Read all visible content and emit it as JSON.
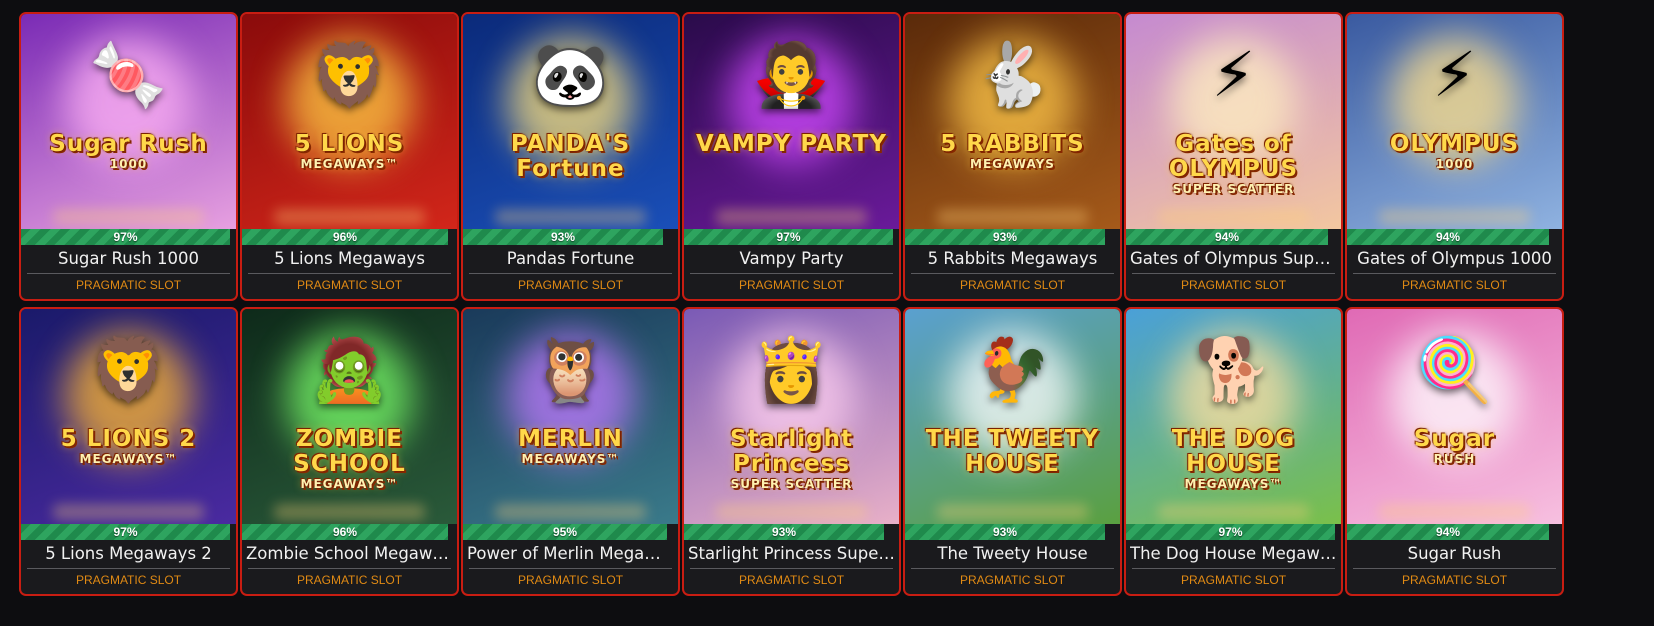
{
  "games": [
    {
      "title": "Sugar Rush 1000",
      "provider": "PRAGMATIC SLOT",
      "rtp": "97%",
      "rtp_value": 97,
      "logo_line1": "Sugar Rush",
      "logo_line2": "1000",
      "icon": "candy-egg-icon",
      "glyph": "🍬",
      "bg1": "#7a2bb5",
      "bg2": "#e7a0e0",
      "glow": "#ffb3f5"
    },
    {
      "title": "5 Lions Megaways",
      "provider": "PRAGMATIC SLOT",
      "rtp": "96%",
      "rtp_value": 96,
      "logo_line1": "5 LIONS",
      "logo_line2": "MEGAWAYS™",
      "icon": "golden-lion-icon",
      "glyph": "🦁",
      "bg1": "#8a0b0b",
      "bg2": "#d2261a",
      "glow": "#ffcc44"
    },
    {
      "title": "Pandas Fortune",
      "provider": "PRAGMATIC SLOT",
      "rtp": "93%",
      "rtp_value": 93,
      "logo_line1": "PANDA'S Fortune",
      "logo_line2": "",
      "icon": "panda-icon",
      "glyph": "🐼",
      "bg1": "#0b2a7a",
      "bg2": "#1a4fb8",
      "glow": "#ffe27a"
    },
    {
      "title": "Vampy Party",
      "provider": "PRAGMATIC SLOT",
      "rtp": "97%",
      "rtp_value": 97,
      "logo_line1": "VAMPY PARTY",
      "logo_line2": "",
      "icon": "vampire-icon",
      "glyph": "🧛",
      "bg1": "#2a0b4a",
      "bg2": "#6a1a9a",
      "glow": "#d24bff"
    },
    {
      "title": "5 Rabbits Megaways",
      "provider": "PRAGMATIC SLOT",
      "rtp": "93%",
      "rtp_value": 93,
      "logo_line1": "5 RABBITS",
      "logo_line2": "MEGAWAYS",
      "icon": "golden-rabbit-icon",
      "glyph": "🐇",
      "bg1": "#5a2a0a",
      "bg2": "#a55a1a",
      "glow": "#ffc84a"
    },
    {
      "title": "Gates of Olympus Super Scatter",
      "provider": "PRAGMATIC SLOT",
      "rtp": "94%",
      "rtp_value": 94,
      "logo_line1": "Gates of OLYMPUS",
      "logo_line2": "SUPER SCATTER",
      "icon": "zeus-icon",
      "glyph": "⚡",
      "bg1": "#c58ad0",
      "bg2": "#f3c7a0",
      "glow": "#fff0c0"
    },
    {
      "title": "Gates of Olympus 1000",
      "provider": "PRAGMATIC SLOT",
      "rtp": "94%",
      "rtp_value": 94,
      "logo_line1": "OLYMPUS",
      "logo_line2": "1000",
      "icon": "zeus-icon",
      "glyph": "⚡",
      "bg1": "#3a5aa0",
      "bg2": "#8fb2e0",
      "glow": "#ffe08a"
    },
    {
      "title": "5 Lions Megaways 2",
      "provider": "PRAGMATIC SLOT",
      "rtp": "97%",
      "rtp_value": 97,
      "logo_line1": "5 LIONS 2",
      "logo_line2": "MEGAWAYS™",
      "icon": "golden-lion-icon",
      "glyph": "🦁",
      "bg1": "#1a1a6a",
      "bg2": "#4a2aa0",
      "glow": "#ffb830"
    },
    {
      "title": "Zombie School Megaways",
      "provider": "PRAGMATIC SLOT",
      "rtp": "96%",
      "rtp_value": 96,
      "logo_line1": "ZOMBIE SCHOOL",
      "logo_line2": "MEGAWAYS™",
      "icon": "zombie-icon",
      "glyph": "🧟",
      "bg1": "#0e2a1a",
      "bg2": "#2a5a3a",
      "glow": "#7aff6a"
    },
    {
      "title": "Power of Merlin Megaways",
      "provider": "PRAGMATIC SLOT",
      "rtp": "95%",
      "rtp_value": 95,
      "logo_line1": "MERLIN",
      "logo_line2": "MEGAWAYS™",
      "icon": "owl-icon",
      "glyph": "🦉",
      "bg1": "#1a3a5a",
      "bg2": "#3a7a8a",
      "glow": "#c07aff"
    },
    {
      "title": "Starlight Princess Super Scatter",
      "provider": "PRAGMATIC SLOT",
      "rtp": "93%",
      "rtp_value": 93,
      "logo_line1": "Starlight Princess",
      "logo_line2": "SUPER SCATTER",
      "icon": "princess-icon",
      "glyph": "👸",
      "bg1": "#7a5ab5",
      "bg2": "#e8b0c8",
      "glow": "#ffd0f0"
    },
    {
      "title": "The Tweety House",
      "provider": "PRAGMATIC SLOT",
      "rtp": "93%",
      "rtp_value": 93,
      "logo_line1": "THE TWEETY HOUSE",
      "logo_line2": "",
      "icon": "rooster-icon",
      "glyph": "🐓",
      "bg1": "#5aa0d0",
      "bg2": "#5aa040",
      "glow": "#ffffff"
    },
    {
      "title": "The Dog House Megaways",
      "provider": "PRAGMATIC SLOT",
      "rtp": "97%",
      "rtp_value": 97,
      "logo_line1": "THE DOG HOUSE",
      "logo_line2": "MEGAWAYS™",
      "icon": "dog-icon",
      "glyph": "🐕",
      "bg1": "#4aa0d8",
      "bg2": "#7ac04a",
      "glow": "#ffe0a0"
    },
    {
      "title": "Sugar Rush",
      "provider": "PRAGMATIC SLOT",
      "rtp": "94%",
      "rtp_value": 94,
      "logo_line1": "Sugar",
      "logo_line2": "RUSH",
      "icon": "candy-egg-icon",
      "glyph": "🍭",
      "bg1": "#e06ab5",
      "bg2": "#f7c0e0",
      "glow": "#ffffff"
    }
  ]
}
